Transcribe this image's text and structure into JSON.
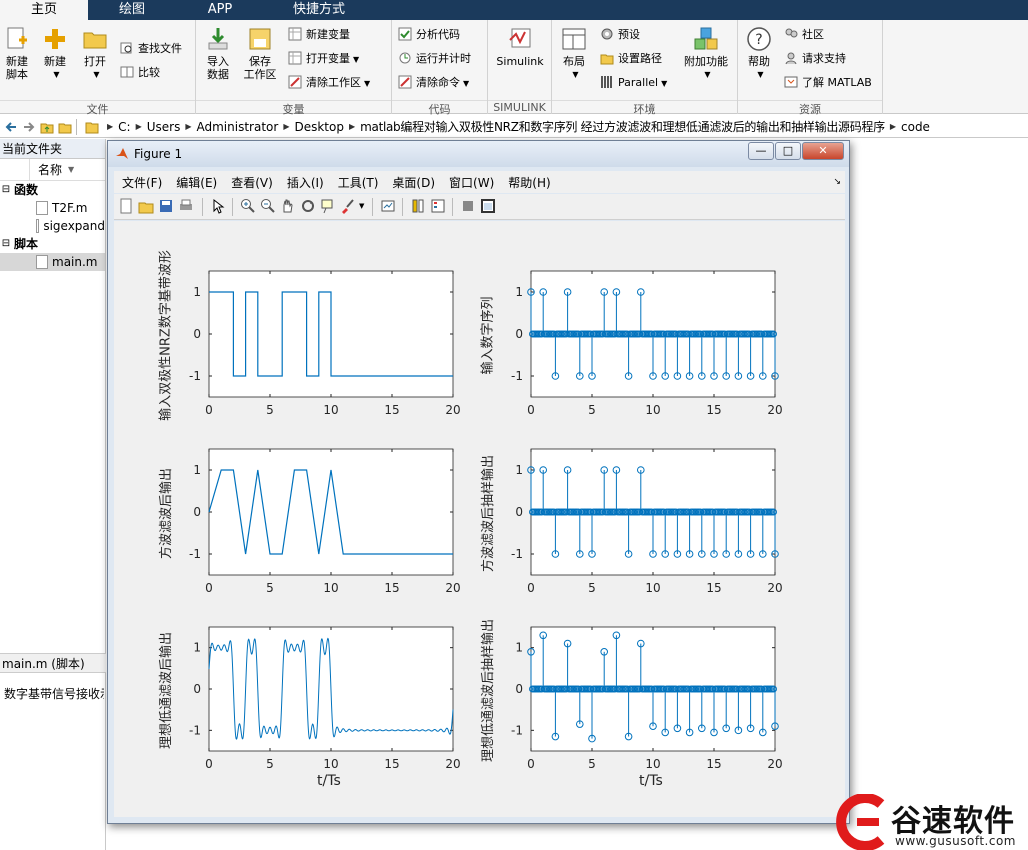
{
  "ribbon": {
    "tabs": [
      "主页",
      "绘图",
      "APP",
      "快捷方式"
    ],
    "active_tab": "主页",
    "groups": [
      {
        "name": "文件",
        "buttons": [
          "新建\n脚本",
          "新建",
          "打开",
          "查找文件",
          "比较"
        ]
      },
      {
        "name": "变量",
        "buttons": [
          "导入\n数据",
          "保存\n工作区",
          "新建变量",
          "打开变量",
          "清除工作区"
        ]
      },
      {
        "name": "代码",
        "buttons": [
          "分析代码",
          "运行并计时",
          "清除命令"
        ]
      },
      {
        "name": "SIMULINK",
        "buttons": [
          "Simulink"
        ]
      },
      {
        "name": "环境",
        "buttons": [
          "布局",
          "预设",
          "设置路径",
          "Parallel",
          "附加功能"
        ]
      },
      {
        "name": "资源",
        "buttons": [
          "帮助",
          "社区",
          "请求支持",
          "了解 MATLAB"
        ]
      }
    ]
  },
  "address": {
    "crumbs": [
      "C:",
      "Users",
      "Administrator",
      "Desktop",
      "matlab编程对输入双极性NRZ和数字序列 经过方波滤波和理想低通滤波后的输出和抽样输出源码程序",
      "code"
    ]
  },
  "left_panel": {
    "title": "当前文件夹",
    "column": "名称",
    "sections": [
      {
        "label": "函数",
        "files": [
          "T2F.m",
          "sigexpand"
        ]
      },
      {
        "label": "脚本",
        "files": [
          "main.m"
        ]
      }
    ],
    "selected": "main.m",
    "detail_label": "main.m  (脚本)",
    "description": "数字基带信号接收示"
  },
  "figure": {
    "title": "Figure 1",
    "menu": [
      "文件(F)",
      "编辑(E)",
      "查看(V)",
      "插入(I)",
      "工具(T)",
      "桌面(D)",
      "窗口(W)",
      "帮助(H)"
    ],
    "window_buttons": [
      "—",
      "□",
      "✕"
    ]
  },
  "colors": {
    "line": "#0072bd",
    "ribbon_tab_bg": "#1b3a5c",
    "axes_bg": "#ffffff",
    "figure_bg": "#f0f0f0"
  },
  "chart_data": [
    {
      "type": "line",
      "ylabel": "输入双极性NRZ数字基带波形",
      "xlabel": "",
      "xlim": [
        0,
        20
      ],
      "ylim": [
        -1.5,
        1.5
      ],
      "xticks": [
        0,
        5,
        10,
        15,
        20
      ],
      "yticks": [
        -1,
        0,
        1
      ],
      "x": [
        0,
        2,
        2,
        3,
        3,
        4,
        4,
        6,
        6,
        8,
        8,
        9,
        9,
        10,
        10,
        20
      ],
      "y": [
        1,
        1,
        -1,
        -1,
        1,
        1,
        -1,
        -1,
        1,
        1,
        -1,
        -1,
        1,
        1,
        -1,
        -1
      ]
    },
    {
      "type": "stem",
      "ylabel": "输入数字序列",
      "xlabel": "",
      "xlim": [
        0,
        20
      ],
      "ylim": [
        -1.5,
        1.5
      ],
      "xticks": [
        0,
        5,
        10,
        15,
        20
      ],
      "yticks": [
        -1,
        0,
        1
      ],
      "x": [
        0,
        1,
        2,
        3,
        4,
        5,
        6,
        7,
        8,
        9,
        10,
        11,
        12,
        13,
        14,
        15,
        16,
        17,
        18,
        19,
        20
      ],
      "y": [
        1,
        1,
        -1,
        1,
        -1,
        -1,
        1,
        1,
        -1,
        1,
        -1,
        -1,
        -1,
        -1,
        -1,
        -1,
        -1,
        -1,
        -1,
        -1,
        -1
      ]
    },
    {
      "type": "line",
      "ylabel": "方波滤波后输出",
      "xlabel": "",
      "xlim": [
        0,
        20
      ],
      "ylim": [
        -1.5,
        1.5
      ],
      "xticks": [
        0,
        5,
        10,
        15,
        20
      ],
      "yticks": [
        -1,
        0,
        1
      ],
      "x": [
        0,
        1,
        2,
        3,
        4,
        5,
        6,
        7,
        8,
        9,
        10,
        11,
        20
      ],
      "y": [
        0,
        1,
        1,
        -1,
        1,
        -1,
        -1,
        1,
        1,
        -1,
        1,
        -1,
        -1
      ]
    },
    {
      "type": "stem",
      "ylabel": "方波滤波后抽样输出",
      "xlabel": "",
      "xlim": [
        0,
        20
      ],
      "ylim": [
        -1.5,
        1.5
      ],
      "xticks": [
        0,
        5,
        10,
        15,
        20
      ],
      "yticks": [
        -1,
        0,
        1
      ],
      "x": [
        0,
        1,
        2,
        3,
        4,
        5,
        6,
        7,
        8,
        9,
        10,
        11,
        12,
        13,
        14,
        15,
        16,
        17,
        18,
        19,
        20
      ],
      "y": [
        1,
        1,
        -1,
        1,
        -1,
        -1,
        1,
        1,
        -1,
        1,
        -1,
        -1,
        -1,
        -1,
        -1,
        -1,
        -1,
        -1,
        -1,
        -1,
        -1
      ]
    },
    {
      "type": "line",
      "ylabel": "理想低通滤波后输出",
      "xlabel": "t/Ts",
      "xlim": [
        0,
        20
      ],
      "ylim": [
        -1.5,
        1.5
      ],
      "xticks": [
        0,
        5,
        10,
        15,
        20
      ],
      "yticks": [
        -1,
        0,
        1
      ],
      "segments": [
        [
          0,
          2,
          1
        ],
        [
          2,
          3,
          -1
        ],
        [
          3,
          4,
          1
        ],
        [
          4,
          6,
          -1
        ],
        [
          6,
          8,
          1
        ],
        [
          8,
          9,
          -1
        ],
        [
          9,
          10,
          1
        ],
        [
          10,
          20,
          -1
        ]
      ]
    },
    {
      "type": "stem",
      "ylabel": "理想低通滤波后抽样输出",
      "xlabel": "t/Ts",
      "xlim": [
        0,
        20
      ],
      "ylim": [
        -1.5,
        1.5
      ],
      "xticks": [
        0,
        5,
        10,
        15,
        20
      ],
      "yticks": [
        -1,
        0,
        1
      ],
      "x": [
        0,
        1,
        2,
        3,
        4,
        5,
        6,
        7,
        8,
        9,
        10,
        11,
        12,
        13,
        14,
        15,
        16,
        17,
        18,
        19,
        20
      ],
      "y": [
        0.9,
        1.3,
        -1.15,
        1.1,
        -0.85,
        -1.2,
        0.9,
        1.3,
        -1.15,
        1.1,
        -0.9,
        -1.05,
        -0.95,
        -1.05,
        -0.95,
        -1.05,
        -0.95,
        -1.0,
        -0.95,
        -1.05,
        -0.9
      ]
    }
  ],
  "watermark": {
    "brand": "谷速软件",
    "url": "www.gususoft.com"
  }
}
